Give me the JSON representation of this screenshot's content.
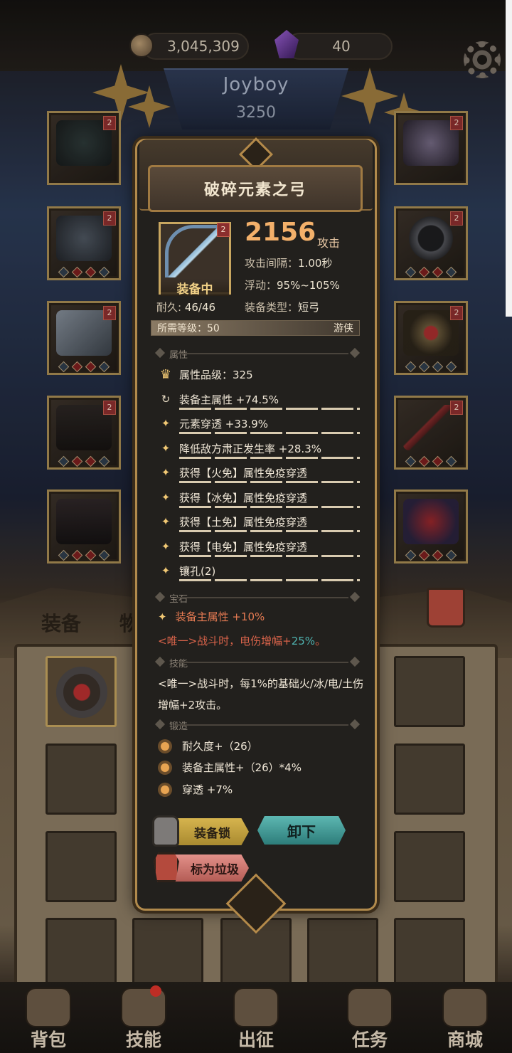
{
  "currency": {
    "gold": "3,045,309",
    "gems": "40"
  },
  "player": {
    "name": "Joyboy",
    "power": "3250"
  },
  "equip_slots": {
    "badge": "2"
  },
  "inventory_tabs": {
    "equipment": "装备",
    "items": "物品"
  },
  "item_popup": {
    "name": "破碎元素之弓",
    "badge": "2",
    "status": "装备中",
    "attack_value": "2156",
    "attack_unit": "攻击",
    "stats": [
      {
        "label": "攻击间隔：",
        "value": "1.00秒"
      },
      {
        "label": "浮动：",
        "value": "95%~105%"
      }
    ],
    "durability_label": "耐久:",
    "durability_value": "46/46",
    "equip_type_label": "装备类型：",
    "equip_type_value": "短弓",
    "required_level_label": "所需等级：",
    "required_level_value": "50",
    "class": "游侠",
    "sections": {
      "attributes": "属性",
      "gems": "宝石",
      "skills": "技能",
      "forging": "锻造"
    },
    "attributes": [
      "属性品级：325",
      "装备主属性 +74.5%",
      "元素穿透 +33.9%",
      "降低敌方肃正发生率 +28.3%",
      "获得【火免】属性免疫穿透",
      "获得【冰免】属性免疫穿透",
      "获得【土免】属性免疫穿透",
      "获得【电免】属性免疫穿透",
      "镶孔(2)"
    ],
    "gem_bonus": "装备主属性 +10%",
    "unique_gem_prefix": "<唯一>战斗时，电伤增幅+",
    "unique_gem_value": "25%",
    "unique_gem_suffix": "。",
    "skill_text": "<唯一>战斗时，每1%的基础火/冰/电/土伤增幅+2攻击。",
    "forging": [
      "耐久度+（26）",
      "装备主属性+（26）*4%",
      "穿透 +7%"
    ],
    "buttons": {
      "lock": "装备锁",
      "unequip": "卸下",
      "junk": "标为垃圾"
    }
  },
  "nav": [
    {
      "label": "背包",
      "icon": "backpack-icon"
    },
    {
      "label": "技能",
      "icon": "skill-book-icon"
    },
    {
      "label": "出征",
      "icon": "expedition-sword-icon"
    },
    {
      "label": "任务",
      "icon": "quest-scroll-icon"
    },
    {
      "label": "商城",
      "icon": "shop-crown-icon"
    }
  ],
  "colors": {
    "accent_gold": "#f3b06a",
    "frame": "#b18a4c",
    "unique_red": "#d9634a",
    "unique_teal": "#4fb3b0"
  }
}
